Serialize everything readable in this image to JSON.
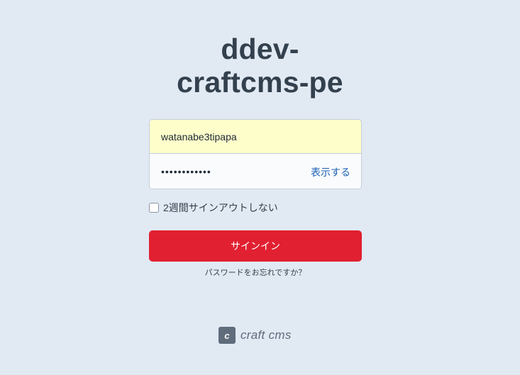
{
  "site": {
    "title_line1": "ddev-",
    "title_line2": "craftcms-pe"
  },
  "login": {
    "username_value": "watanabe3tipapa",
    "password_value": "••••••••••••",
    "show_password_label": "表示する",
    "remember_label": "2週間サインアウトしない",
    "remember_checked": false,
    "submit_label": "サインイン",
    "forgot_label": "パスワードをお忘れですか？"
  },
  "footer": {
    "logo_mark": "c",
    "logo_text": "craft cms"
  },
  "colors": {
    "background": "#e1e9f3",
    "primary_button": "#e12031",
    "link": "#1a5fb4",
    "autofill": "#fefecb"
  }
}
